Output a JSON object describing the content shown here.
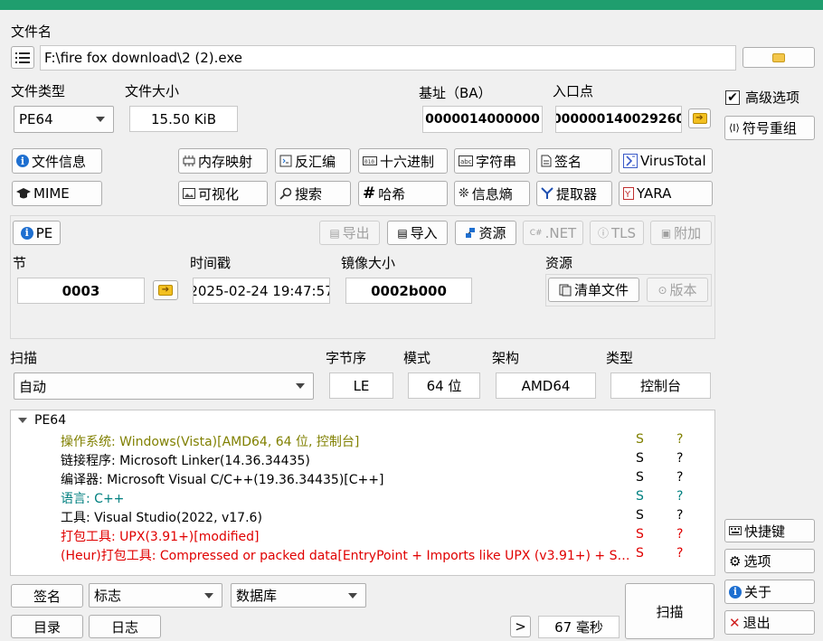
{
  "file": {
    "label": "文件名",
    "path": "F:\\fire fox download\\2 (2).exe"
  },
  "info": {
    "file_type_label": "文件类型",
    "file_type_value": "PE64",
    "file_size_label": "文件大小",
    "file_size_value": "15.50 KiB",
    "base_label": "基址（BA）",
    "base_value": "0000014000000",
    "entry_label": "入口点",
    "entry_value": "000000140029260"
  },
  "tools": {
    "file_info": "文件信息",
    "memory_map": "内存映射",
    "disasm": "反汇编",
    "hex": "十六进制",
    "strings": "字符串",
    "signatures": "签名",
    "virustotal": "VirusTotal",
    "mime": "MIME",
    "visualize": "可视化",
    "search": "搜索",
    "hash": "哈希",
    "entropy": "信息熵",
    "extractor": "提取器",
    "yara": "YARA"
  },
  "pe_panel": {
    "pe_button": "PE",
    "export": "导出",
    "import": "导入",
    "resources": "资源",
    "dotnet": ".NET",
    "tls": "TLS",
    "overlay": "附加",
    "sections_label": "节",
    "sections_value": "0003",
    "timestamp_label": "时间戳",
    "timestamp_value": "2025-02-24 19:47:57",
    "image_size_label": "镜像大小",
    "image_size_value": "0002b000",
    "resources_label": "资源",
    "manifest": "清单文件",
    "version": "版本"
  },
  "scan": {
    "scan_label": "扫描",
    "scan_mode": "自动",
    "endian_label": "字节序",
    "endian_value": "LE",
    "mode_label": "模式",
    "mode_value": "64 位",
    "arch_label": "架构",
    "arch_value": "AMD64",
    "type_label": "类型",
    "type_value": "控制台"
  },
  "results": {
    "root": "PE64",
    "rows": [
      {
        "text": "操作系统: Windows(Vista)[AMD64, 64 位, 控制台]",
        "s": "S",
        "q": "?",
        "color": "#808000"
      },
      {
        "text": "链接程序: Microsoft Linker(14.36.34435)",
        "s": "S",
        "q": "?",
        "color": "#000000"
      },
      {
        "text": "编译器: Microsoft Visual C/C++(19.36.34435)[C++]",
        "s": "S",
        "q": "?",
        "color": "#000000"
      },
      {
        "text": "语言: C++",
        "s": "S",
        "q": "?",
        "color": "#008080"
      },
      {
        "text": "工具: Visual Studio(2022, v17.6)",
        "s": "S",
        "q": "?",
        "color": "#000000"
      },
      {
        "text": "打包工具: UPX(3.91+)[modified]",
        "s": "S",
        "q": "?",
        "color": "#e00000"
      },
      {
        "text": "(Heur)打包工具: Compressed or packed data[EntryPoint + Imports like UPX (v3.91+) + Se...",
        "s": "S",
        "q": "?",
        "color": "#e00000"
      }
    ]
  },
  "bottom": {
    "signatures": "签名",
    "flags": "标志",
    "database": "数据库",
    "directory": "目录",
    "log": "日志",
    "more": ">",
    "elapsed": "67 毫秒",
    "scan": "扫描"
  },
  "right": {
    "advanced": "高级选项",
    "demangle": "符号重组",
    "shortcuts": "快捷键",
    "options": "选项",
    "about": "关于",
    "exit": "退出"
  }
}
